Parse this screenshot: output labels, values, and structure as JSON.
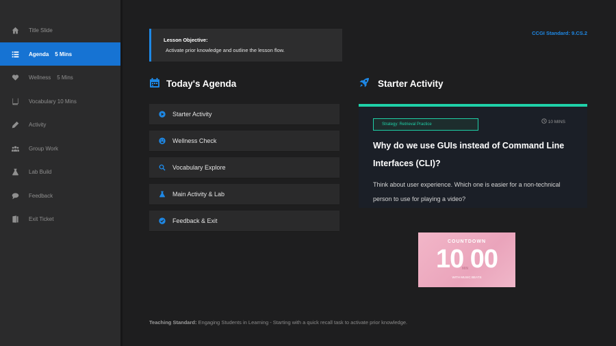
{
  "sidebar": {
    "items": [
      {
        "label": "Title Slide",
        "icon": "home-icon"
      },
      {
        "label": "Agenda    5 Mins",
        "icon": "list-icon"
      },
      {
        "label": "Wellness    5 Mins",
        "icon": "heart-icon"
      },
      {
        "label": "Vocabulary 10 Mins",
        "icon": "book-icon"
      },
      {
        "label": "Activity",
        "icon": "pencil-icon"
      },
      {
        "label": "Group Work",
        "icon": "users-icon"
      },
      {
        "label": "Lab Build",
        "icon": "flask-icon"
      },
      {
        "label": "Feedback",
        "icon": "comment-icon"
      },
      {
        "label": "Exit Ticket",
        "icon": "door-icon"
      }
    ],
    "active_index": 1
  },
  "objective": {
    "title": "Lesson Objective:",
    "text": "Activate prior knowledge and outline the lesson flow."
  },
  "standard": "CCGI Standard: 9.CS.2",
  "agenda": {
    "heading": "Today's Agenda",
    "items": [
      {
        "label": "Starter Activity",
        "icon": "play-icon"
      },
      {
        "label": "Wellness Check",
        "icon": "smile-icon"
      },
      {
        "label": "Vocabulary Explore",
        "icon": "search-icon"
      },
      {
        "label": "Main Activity & Lab",
        "icon": "flask-icon"
      },
      {
        "label": "Feedback & Exit",
        "icon": "check-circle-icon"
      }
    ]
  },
  "starter": {
    "heading": "Starter Activity",
    "strategy": "Strategy: Retrieval Practice",
    "time": "10 MINS",
    "question": "Why do we use GUIs instead of Command Line Interfaces (CLI)?",
    "prompt": "Think about user experience. Which one is easier for a non-technical person to use for playing a video?"
  },
  "countdown": {
    "title": "COUNTDOWN",
    "number": "10 00",
    "unit": "MIN",
    "footer": "WITH MUSIC BEATS"
  },
  "footer": {
    "label": "Teaching Standard:",
    "text": " Engaging Students in Learning - Starting with a quick recall task to activate prior knowledge."
  },
  "colors": {
    "accent": "#1e88e5",
    "active_bg": "#1673d3",
    "teal": "#1fd1a8"
  }
}
